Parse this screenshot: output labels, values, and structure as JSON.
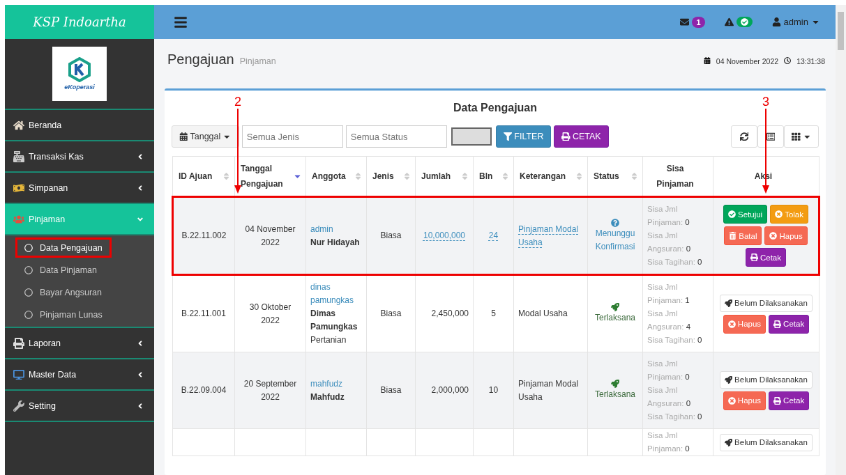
{
  "brand": {
    "title": "KSP Indoartha",
    "logo_text": "eKoperasi"
  },
  "navbar": {
    "messages": "1",
    "alerts_ok": true,
    "user": "admin"
  },
  "sidebar": {
    "items": [
      {
        "label": "Beranda",
        "kind": "link"
      },
      {
        "label": "Transaksi Kas",
        "kind": "menu",
        "expanded": false
      },
      {
        "label": "Simpanan",
        "kind": "menu",
        "expanded": false
      },
      {
        "label": "Pinjaman",
        "kind": "menu",
        "expanded": true,
        "children": [
          {
            "label": "Data Pengajuan",
            "selected": true,
            "annotated": true
          },
          {
            "label": "Data Pinjaman",
            "selected": false,
            "annotated": false
          },
          {
            "label": "Bayar Angsuran",
            "selected": false,
            "annotated": false
          },
          {
            "label": "Pinjaman Lunas",
            "selected": false,
            "annotated": false
          }
        ]
      },
      {
        "label": "Laporan",
        "kind": "menu",
        "expanded": false
      },
      {
        "label": "Master Data",
        "kind": "menu",
        "expanded": false
      },
      {
        "label": "Setting",
        "kind": "menu",
        "expanded": false
      }
    ]
  },
  "page": {
    "title": "Pengajuan",
    "subtitle": "Pinjaman",
    "date": "04 November 2022",
    "time": "13:31:38"
  },
  "card": {
    "title": "Data Pengajuan",
    "toolbar": {
      "date_filter": "Tanggal",
      "jenis_placeholder": "Semua Jenis",
      "status_placeholder": "Semua Status",
      "filter_button": "FILTER",
      "print_button": "CETAK"
    }
  },
  "table": {
    "columns": [
      {
        "label": "ID Ajuan",
        "sortable": true,
        "sorted": false
      },
      {
        "label": "Tanggal Pengajuan",
        "sortable": true,
        "sorted": true,
        "annotation": {
          "label": "2",
          "centered": false
        }
      },
      {
        "label": "Anggota",
        "sortable": true,
        "sorted": false
      },
      {
        "label": "Jenis",
        "sortable": true,
        "sorted": false
      },
      {
        "label": "Jumlah",
        "sortable": true,
        "sorted": false
      },
      {
        "label": "Bln",
        "sortable": true,
        "sorted": false
      },
      {
        "label": "Keterangan",
        "sortable": true,
        "sorted": false
      },
      {
        "label": "Status",
        "sortable": true,
        "sorted": false
      },
      {
        "label": "Sisa Pinjaman",
        "sortable": false
      },
      {
        "label": "Aksi",
        "sortable": false,
        "annotation": {
          "label": "3",
          "centered": true
        }
      }
    ],
    "rows": [
      {
        "id": "B.22.11.002",
        "tanggal": "04 November 2022",
        "username": "admin",
        "name": "Nur Hidayah",
        "jenis": "Biasa",
        "jumlah": "10,000,000",
        "bln": "24",
        "keterangan": "Pinjaman Modal Usaha",
        "editable": true,
        "annotated": true,
        "status": {
          "kind": "pending",
          "label": "Menunggu Konfirmasi"
        },
        "sisa": [
          {
            "label": "Sisa Jml Pinjaman:",
            "value": "0"
          },
          {
            "label": "Sisa Jml Angsuran:",
            "value": "0"
          },
          {
            "label": "Sisa Tagihan:",
            "value": "0"
          }
        ],
        "actions": [
          {
            "label": "Setujui",
            "kind": "approve"
          },
          {
            "label": "Tolak",
            "kind": "reject"
          },
          {
            "label": "Batal",
            "kind": "cancel"
          },
          {
            "label": "Hapus",
            "kind": "delete"
          },
          {
            "label": "Cetak",
            "kind": "print"
          }
        ]
      },
      {
        "id": "B.22.11.001",
        "tanggal": "30 Oktober 2022",
        "username": "dinas pamungkas",
        "name": "Dimas Pamungkas",
        "group": "Pertanian",
        "jenis": "Biasa",
        "jumlah": "2,450,000",
        "bln": "5",
        "keterangan": "Modal Usaha",
        "editable": false,
        "annotated": false,
        "status": {
          "kind": "done",
          "label": "Terlaksana"
        },
        "sisa": [
          {
            "label": "Sisa Jml Pinjaman:",
            "value": "1"
          },
          {
            "label": "Sisa Jml Angsuran:",
            "value": "4"
          },
          {
            "label": "Sisa Tagihan:",
            "value": "0"
          }
        ],
        "actions": [
          {
            "label": "Belum Dilaksanakan",
            "kind": "pending"
          },
          {
            "label": "Hapus",
            "kind": "delete"
          },
          {
            "label": "Cetak",
            "kind": "print"
          }
        ]
      },
      {
        "id": "B.22.09.004",
        "tanggal": "20 September 2022",
        "username": "mahfudz",
        "name": "Mahfudz",
        "jenis": "Biasa",
        "jumlah": "2,000,000",
        "bln": "10",
        "keterangan": "Pinjaman Modal Usaha",
        "editable": false,
        "annotated": false,
        "status": {
          "kind": "done",
          "label": "Terlaksana"
        },
        "sisa": [
          {
            "label": "Sisa Jml Pinjaman:",
            "value": "0"
          },
          {
            "label": "Sisa Jml Angsuran:",
            "value": "0"
          },
          {
            "label": "Sisa Tagihan:",
            "value": "0"
          }
        ],
        "actions": [
          {
            "label": "Belum Dilaksanakan",
            "kind": "pending"
          },
          {
            "label": "Hapus",
            "kind": "delete"
          },
          {
            "label": "Cetak",
            "kind": "print"
          }
        ]
      },
      {
        "annotated": false,
        "sisa": [
          {
            "label": "Sisa Jml Pinjaman:",
            "value": "0"
          }
        ],
        "actions": [
          {
            "label": "Belum Dilaksanakan",
            "kind": "pending"
          }
        ]
      }
    ]
  }
}
